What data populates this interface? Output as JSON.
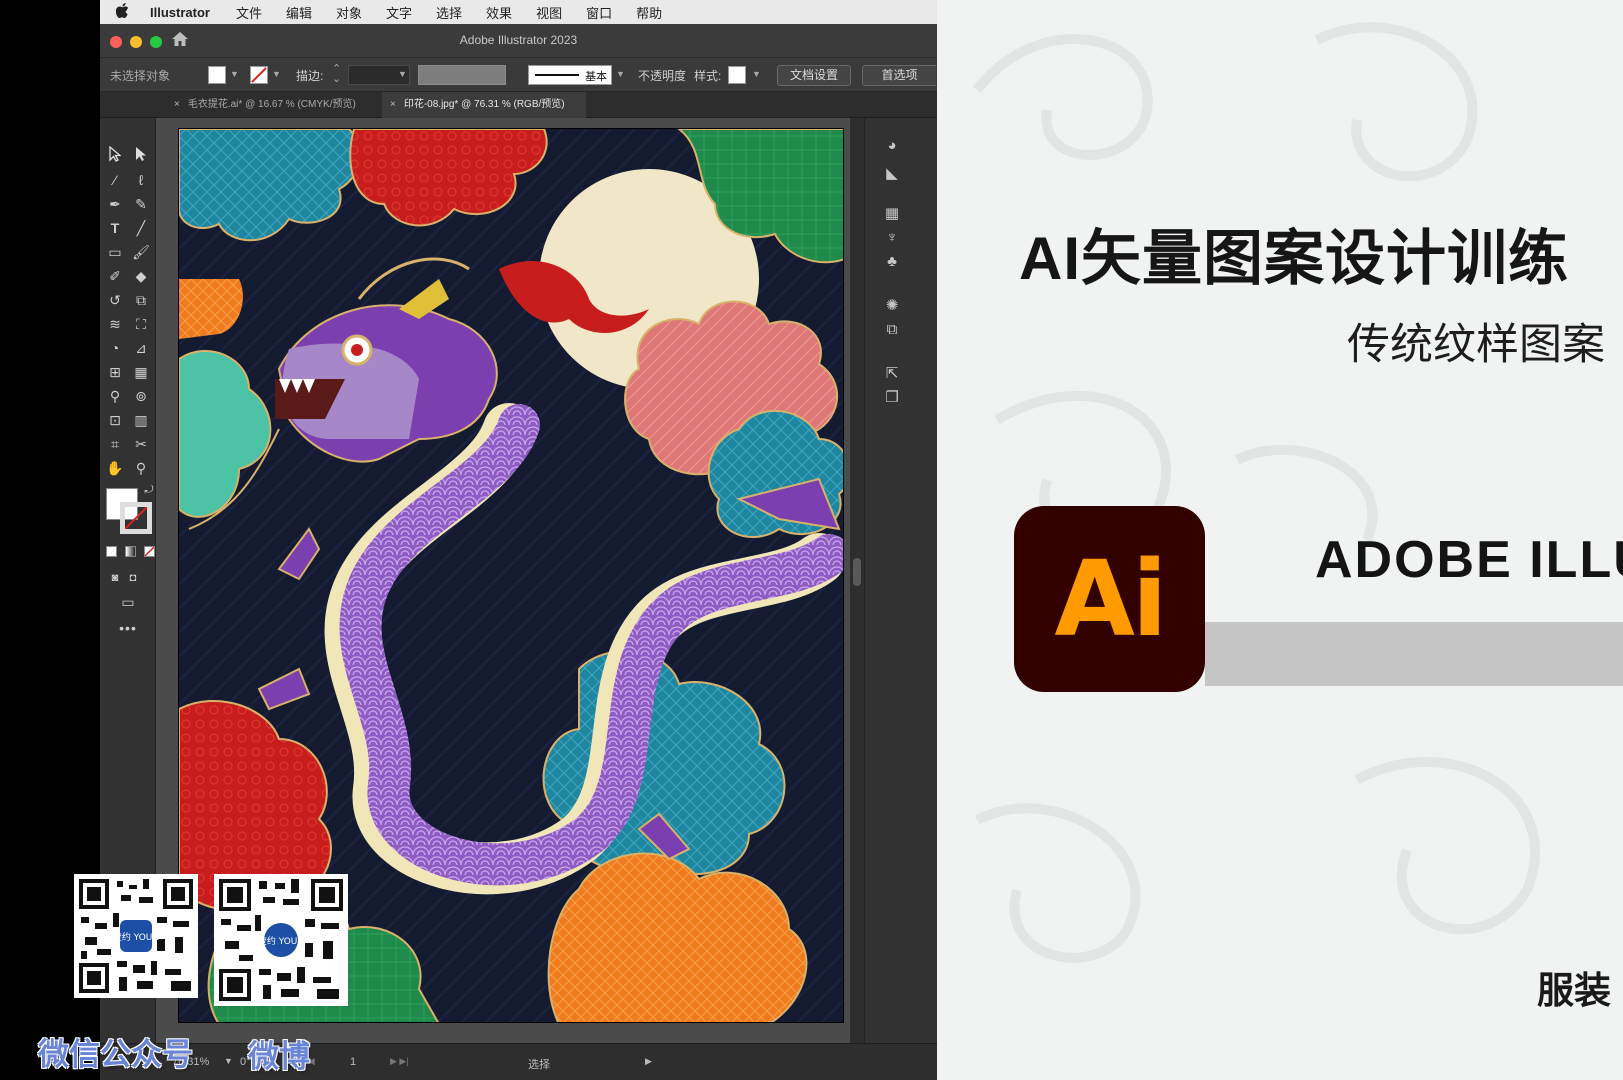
{
  "menubar": {
    "apple": "",
    "app_name": "Illustrator",
    "items": [
      "文件",
      "编辑",
      "对象",
      "文字",
      "选择",
      "效果",
      "视图",
      "窗口",
      "帮助"
    ]
  },
  "window": {
    "title": "Adobe Illustrator 2023"
  },
  "control_bar": {
    "selection_status": "未选择对象",
    "stroke_label": "描边:",
    "stroke_style": "基本",
    "opacity_label": "不透明度",
    "style_label": "样式:",
    "doc_setup_button": "文档设置",
    "prefs_button": "首选项"
  },
  "tabs": [
    {
      "label": "毛衣提花.ai* @ 16.67 % (CMYK/预览)",
      "active": false
    },
    {
      "label": "印花-08.jpg* @ 76.31 % (RGB/预览)",
      "active": true
    }
  ],
  "status_bar": {
    "zoom": "76.31%",
    "rotation": "0°",
    "artboard_number": "1",
    "tool_name": "选择"
  },
  "slide": {
    "title": "AI矢量图案设计训练",
    "subtitle": "传统纹样图案",
    "logo_text": "Ai",
    "brand": "ADOBE ILLUSTRATOR",
    "bottom_text": "服装"
  },
  "overlay": {
    "wechat_label": "微信公众号",
    "weibo_label": "微博",
    "qr_badge": "壹约 YOUN"
  },
  "colors": {
    "ai_logo_bg": "#330000",
    "ai_logo_fg": "#ff9a00",
    "artboard_bg": "#141a30",
    "overlay_label": "#6a84d6"
  }
}
